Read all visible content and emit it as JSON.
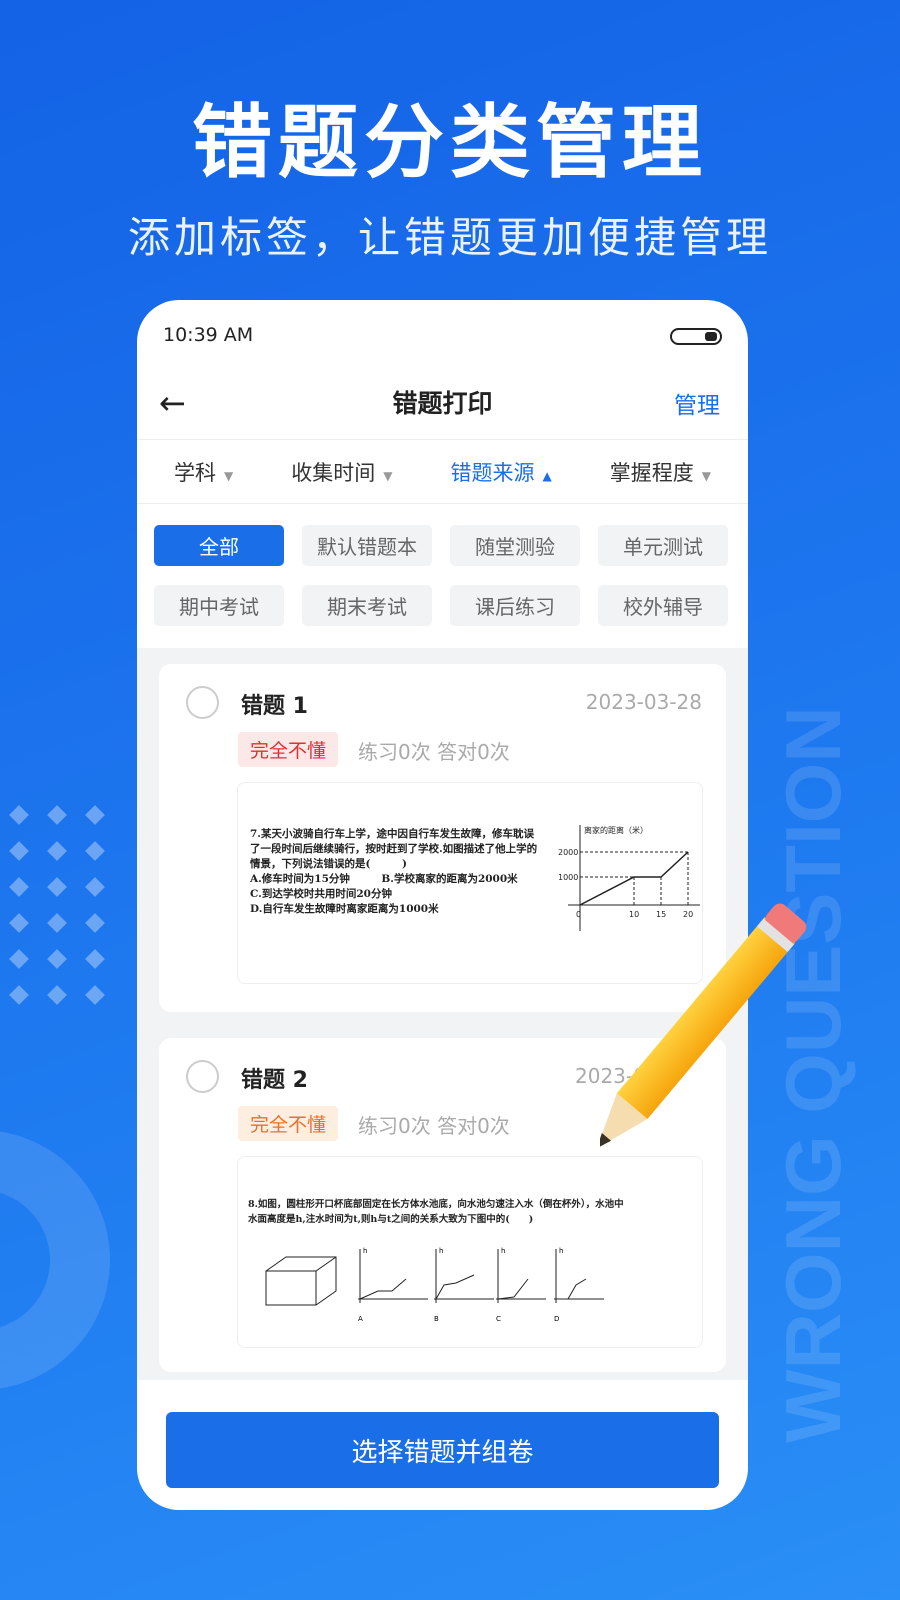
{
  "hero": {
    "title": "错题分类管理",
    "subtitle": "添加标签，让错题更加便捷管理",
    "watermark": "WRONG QUESTION"
  },
  "status_bar": {
    "time": "10:39 AM"
  },
  "nav": {
    "title": "错题打印",
    "manage_label": "管理"
  },
  "filters": [
    {
      "label": "学科",
      "active": false
    },
    {
      "label": "收集时间",
      "active": false
    },
    {
      "label": "错题来源",
      "active": true
    },
    {
      "label": "掌握程度",
      "active": false
    }
  ],
  "sources": [
    "全部",
    "默认错题本",
    "随堂测验",
    "单元测试",
    "期中考试",
    "期末考试",
    "课后练习",
    "校外辅导"
  ],
  "selected_source": "全部",
  "cards": [
    {
      "title": "错题 1",
      "date": "2023-03-28",
      "tag": "完全不懂",
      "stats": "练习0次 答对0次",
      "question": [
        "7.某天小波骑自行车上学，途中因自行车发生故障，修车耽误",
        "了一段时间后继续骑行，按时赶到了学校.如图描述了他上学的",
        "情景，下列说法错误的是(　　　)",
        "A.修车时间为15分钟　　　B.学校离家的距离为2000米",
        "C.到达学校时共用时间20分钟",
        "D.自行车发生故障时离家距离为1000米"
      ],
      "graph": {
        "ylabel": "离家的距离（米）",
        "yticks": [
          "2000",
          "1000"
        ],
        "xticks": [
          "0",
          "10",
          "15",
          "20"
        ]
      }
    },
    {
      "title": "错题 2",
      "date": "2023-0",
      "tag": "完全不懂",
      "stats": "练习0次 答对0次",
      "question": [
        "8.如图，圆柱形开口杯底部固定在长方体水池底，向水池匀速注入水（倒在杯外），水池中",
        "水面高度是h,注水时间为t,则h与t之间的关系大致为下图中的(　　)"
      ],
      "options": [
        "A",
        "B",
        "C",
        "D"
      ]
    }
  ],
  "colors": {
    "primary": "#1a6ee8",
    "tag1_bg": "#fde8e8",
    "tag1_fg": "#e0302f",
    "tag2_bg": "#fdeee0",
    "tag2_fg": "#e8702a"
  },
  "bottom_button": "选择错题并组卷"
}
